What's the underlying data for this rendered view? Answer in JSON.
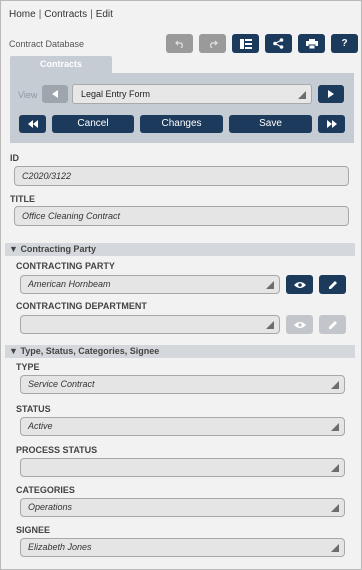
{
  "breadcrumb": {
    "home": "Home",
    "contracts": "Contracts",
    "current": "Edit",
    "separator": "|"
  },
  "header": {
    "db_title": "Contract Database"
  },
  "toolbar": {
    "icons": [
      "undo-icon",
      "redo-icon",
      "list-icon",
      "share-icon",
      "print-icon"
    ],
    "help_label": "?"
  },
  "tab": {
    "label": "Contracts"
  },
  "view": {
    "label": "View",
    "selected": "Legal Entry Form"
  },
  "actions": {
    "cancel": "Cancel",
    "changes": "Changes",
    "save": "Save"
  },
  "fields": {
    "id": {
      "label": "ID",
      "value": "C2020/3122"
    },
    "title": {
      "label": "TITLE",
      "value": "Office Cleaning Contract"
    }
  },
  "sections": {
    "contracting_party": {
      "header": "Contracting Party",
      "party_label": "CONTRACTING PARTY",
      "party_value": "American Hornbeam",
      "department_label": "CONTRACTING DEPARTMENT",
      "department_value": ""
    },
    "type_status": {
      "header": "Type, Status, Categories, Signee",
      "type_label": "TYPE",
      "type_value": "Service Contract",
      "status_label": "STATUS",
      "status_value": "Active",
      "process_label": "PROCESS STATUS",
      "process_value": "",
      "categories_label": "CATEGORIES",
      "categories_value": "Operations",
      "signee_label": "SIGNEE",
      "signee_value": "Elizabeth Jones"
    }
  },
  "colors": {
    "primary": "#1b3a5c",
    "disabled": "#9a9a9a",
    "panel": "#c6ccd3",
    "section": "#d4d7db"
  }
}
